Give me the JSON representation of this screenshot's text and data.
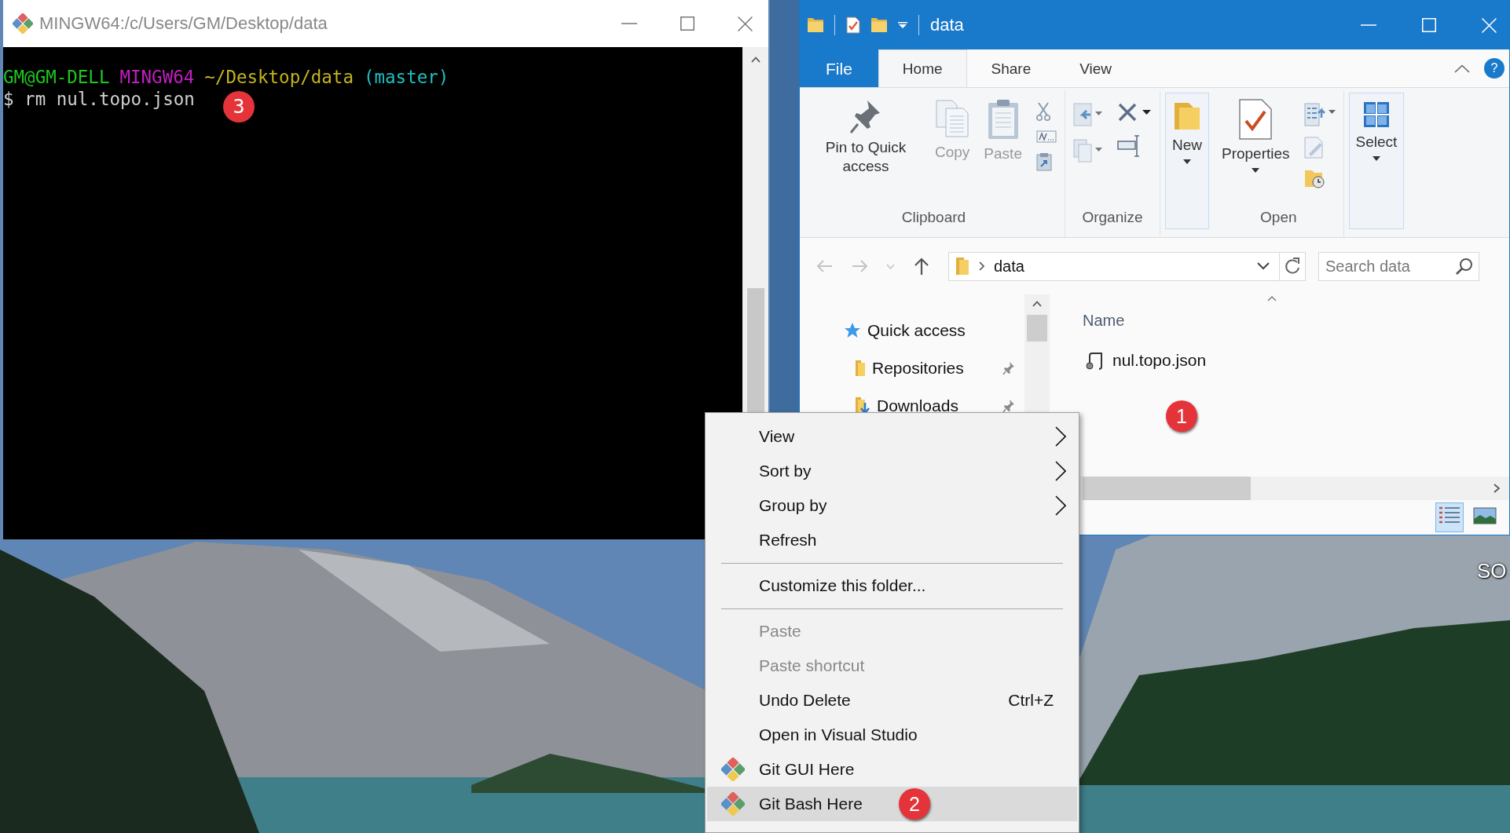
{
  "terminal": {
    "title": "MINGW64:/c/Users/GM/Desktop/data",
    "prompt": [
      {
        "text": "GM@GM-DELL",
        "color": "#1ec81e"
      },
      {
        "text": "MINGW64",
        "color": "#c21ec2"
      },
      {
        "text": "~/Desktop/data",
        "color": "#c4b41e"
      },
      {
        "text": "(master)",
        "color": "#1ebfc4"
      }
    ],
    "command": "$ rm nul.topo.json",
    "badge": "3"
  },
  "explorer": {
    "title": "data",
    "help": "?",
    "tabs": [
      {
        "label": "File",
        "kind": "file",
        "selected": false
      },
      {
        "label": "Home",
        "kind": "tab",
        "selected": true
      },
      {
        "label": "Share",
        "kind": "tab",
        "selected": false
      },
      {
        "label": "View",
        "kind": "tab",
        "selected": false
      }
    ],
    "ribbon": [
      {
        "label": "Clipboard",
        "buttons": [
          {
            "label": "Pin to Quick access",
            "kind": "pin",
            "disabled": false,
            "dropdown": false
          },
          {
            "label": "Copy",
            "kind": "copy",
            "disabled": true,
            "dropdown": false
          },
          {
            "label": "Paste",
            "kind": "paste",
            "disabled": true,
            "dropdown": false
          }
        ]
      },
      {
        "label": "Organize"
      },
      {
        "buttons": [
          {
            "label": "New",
            "kind": "folder",
            "disabled": false,
            "dropdown": true
          }
        ]
      },
      {
        "label": "Open",
        "buttons": [
          {
            "label": "Properties",
            "kind": "properties",
            "disabled": false,
            "dropdown": true
          }
        ]
      },
      {
        "buttons": [
          {
            "label": "Select",
            "kind": "select",
            "disabled": false,
            "dropdown": true
          }
        ]
      }
    ],
    "address": {
      "path": "data"
    },
    "search": {
      "placeholder": "Search data"
    },
    "nav": [
      {
        "label": "Quick access",
        "kind": "star",
        "pinned": false,
        "children": [
          {
            "label": "Repositories",
            "kind": "folder",
            "pinned": true
          },
          {
            "label": "Downloads",
            "kind": "download",
            "pinned": true
          }
        ]
      }
    ],
    "column": "Name",
    "files": [
      {
        "name": "nul.topo.json"
      }
    ],
    "badge": "1"
  },
  "context_menu": {
    "items": [
      {
        "kind": "item",
        "label": "View",
        "submenu": true,
        "disabled": false,
        "selected": false
      },
      {
        "kind": "item",
        "label": "Sort by",
        "submenu": true,
        "disabled": false,
        "selected": false
      },
      {
        "kind": "item",
        "label": "Group by",
        "submenu": true,
        "disabled": false,
        "selected": false
      },
      {
        "kind": "item",
        "label": "Refresh",
        "submenu": false,
        "disabled": false,
        "selected": false
      },
      {
        "kind": "separator"
      },
      {
        "kind": "item",
        "label": "Customize this folder...",
        "submenu": false,
        "disabled": false,
        "selected": false
      },
      {
        "kind": "separator"
      },
      {
        "kind": "item",
        "label": "Paste",
        "submenu": false,
        "disabled": true,
        "selected": false
      },
      {
        "kind": "item",
        "label": "Paste shortcut",
        "submenu": false,
        "disabled": true,
        "selected": false
      },
      {
        "kind": "item",
        "label": "Undo Delete",
        "shortcut": "Ctrl+Z",
        "submenu": false,
        "disabled": false,
        "selected": false
      },
      {
        "kind": "item",
        "label": "Open in Visual Studio",
        "submenu": false,
        "disabled": false,
        "selected": false
      },
      {
        "kind": "git",
        "label": "Git GUI Here",
        "submenu": false,
        "disabled": false,
        "selected": false
      },
      {
        "kind": "git",
        "label": "Git Bash Here",
        "submenu": false,
        "disabled": false,
        "selected": true,
        "badge": "2"
      }
    ]
  },
  "desktop": {
    "icon_labels": [
      "SO"
    ]
  }
}
